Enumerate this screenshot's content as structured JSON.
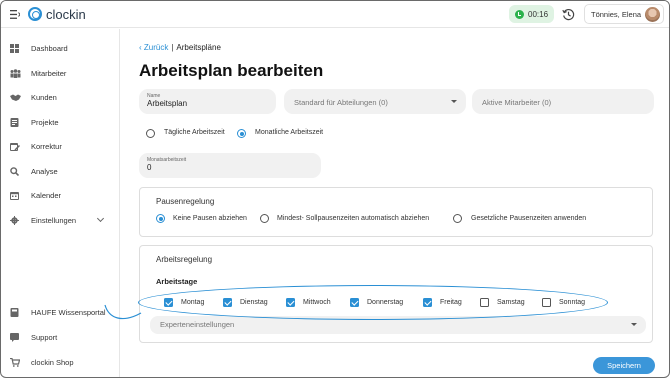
{
  "app": {
    "logo_text": "clockin"
  },
  "topbar": {
    "timer": "00:16",
    "user_name": "Tönnies, Elena"
  },
  "sidebar": {
    "items": [
      {
        "label": "Dashboard",
        "icon": "dashboard-icon"
      },
      {
        "label": "Mitarbeiter",
        "icon": "people-icon"
      },
      {
        "label": "Kunden",
        "icon": "handshake-icon"
      },
      {
        "label": "Projekte",
        "icon": "projects-icon"
      },
      {
        "label": "Korrektur",
        "icon": "calendar-edit-icon"
      },
      {
        "label": "Analyse",
        "icon": "analysis-icon"
      },
      {
        "label": "Kalender",
        "icon": "calendar-icon"
      },
      {
        "label": "Einstellungen",
        "icon": "gear-icon"
      }
    ],
    "bottom_items": [
      {
        "label": "HAUFE Wissensportal",
        "icon": "book-icon"
      },
      {
        "label": "Support",
        "icon": "support-icon"
      },
      {
        "label": "clockin Shop",
        "icon": "cart-icon"
      }
    ]
  },
  "breadcrumb": {
    "back": "Zurück",
    "separator": "|",
    "current": "Arbeitspläne"
  },
  "page": {
    "title": "Arbeitsplan bearbeiten"
  },
  "form": {
    "name_label": "Name",
    "name_value": "Arbeitsplan",
    "standard_placeholder": "Standard für Abteilungen (0)",
    "employees_placeholder": "Aktive Mitarbeiter (0)",
    "worktime_options": [
      {
        "label": "Tägliche Arbeitszeit",
        "selected": false
      },
      {
        "label": "Monatliche Arbeitszeit",
        "selected": true
      }
    ],
    "monthly_label": "Monatsarbeitszeit",
    "monthly_value": "0"
  },
  "pause": {
    "title": "Pausenregelung",
    "options": [
      {
        "label": "Keine Pausen abziehen",
        "selected": true
      },
      {
        "label": "Mindest- Sollpausenzeiten automatisch abziehen",
        "selected": false
      },
      {
        "label": "Gesetzliche Pausenzeiten anwenden",
        "selected": false
      }
    ]
  },
  "work": {
    "title": "Arbeitsregelung",
    "days_title": "Arbeitstage",
    "days": [
      {
        "label": "Montag",
        "checked": true
      },
      {
        "label": "Dienstag",
        "checked": true
      },
      {
        "label": "Mittwoch",
        "checked": true
      },
      {
        "label": "Donnerstag",
        "checked": true
      },
      {
        "label": "Freitag",
        "checked": true
      },
      {
        "label": "Samstag",
        "checked": false
      },
      {
        "label": "Sonntag",
        "checked": false
      }
    ],
    "expert_label": "Experteneinstellungen"
  },
  "actions": {
    "save_label": "Speichern"
  },
  "colors": {
    "accent": "#2a8fd4",
    "timer_bg": "#dff3e3",
    "timer_dot": "#2bb24c"
  }
}
